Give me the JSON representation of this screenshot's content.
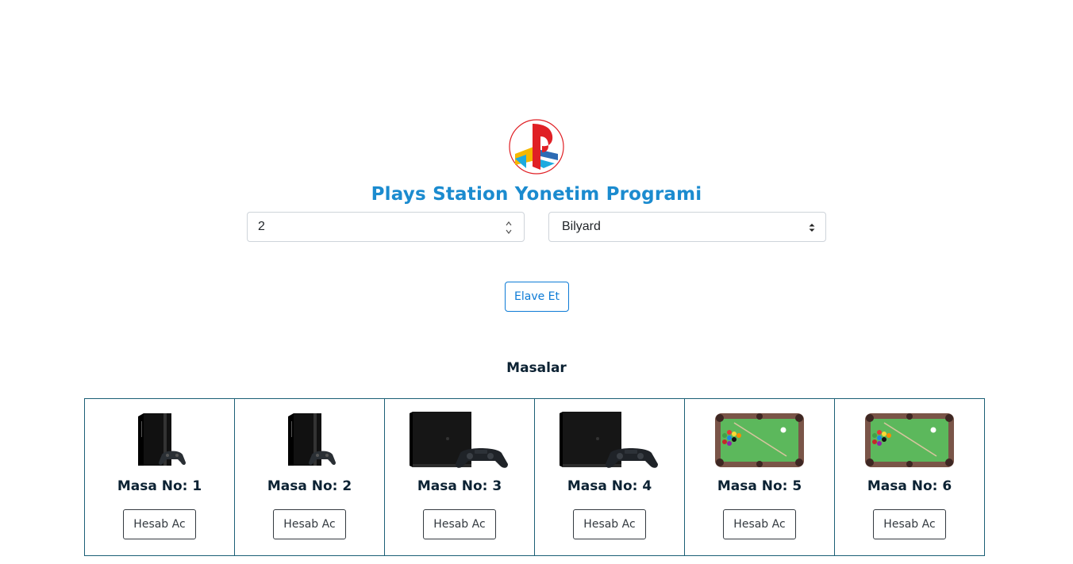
{
  "header": {
    "logo_icon": "playstation-logo-icon",
    "title": "Plays Station Yonetim Programi",
    "title_color": "#1b8bcf"
  },
  "form": {
    "count_value": "2",
    "type_selected": "Bilyard",
    "add_button_label": "Elave Et",
    "accent_color": "#0d7bd6"
  },
  "tables_section": {
    "title": "Masalar",
    "border_color": "#1b5f76",
    "items": [
      {
        "label": "Masa No: 1",
        "image_icon": "ps3-console-icon",
        "button_label": "Hesab Ac"
      },
      {
        "label": "Masa No: 2",
        "image_icon": "ps3-console-icon",
        "button_label": "Hesab Ac"
      },
      {
        "label": "Masa No: 3",
        "image_icon": "ps4-console-icon",
        "button_label": "Hesab Ac"
      },
      {
        "label": "Masa No: 4",
        "image_icon": "ps4-console-icon",
        "button_label": "Hesab Ac"
      },
      {
        "label": "Masa No: 5",
        "image_icon": "billiard-table-icon",
        "button_label": "Hesab Ac"
      },
      {
        "label": "Masa No: 6",
        "image_icon": "billiard-table-icon",
        "button_label": "Hesab Ac"
      }
    ]
  }
}
